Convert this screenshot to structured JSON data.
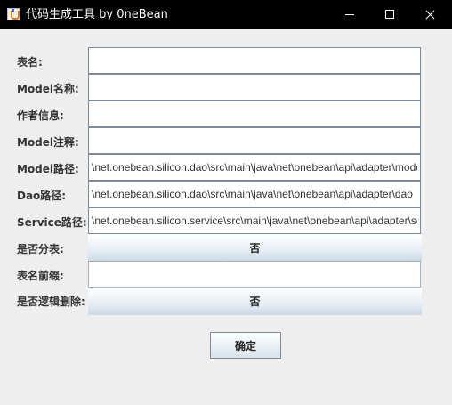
{
  "window": {
    "title": "代码生成工具 by 0neBean",
    "icon": "java-cup-icon",
    "controls": [
      "minimize-icon",
      "maximize-icon",
      "close-icon"
    ]
  },
  "form": {
    "table_name": {
      "label": "表名:",
      "value": ""
    },
    "model_name": {
      "label": "Model名称:",
      "value": ""
    },
    "author_info": {
      "label": "作者信息:",
      "value": ""
    },
    "model_comment": {
      "label": "Model注释:",
      "value": ""
    },
    "model_path": {
      "label": "Model路径:",
      "value": "\\net.onebean.silicon.dao\\src\\main\\java\\net\\onebean\\api\\adapter\\model"
    },
    "dao_path": {
      "label": "Dao路径:",
      "value": "\\net.onebean.silicon.dao\\src\\main\\java\\net\\onebean\\api\\adapter\\dao"
    },
    "service_path": {
      "label": "Service路径:",
      "value": "\\net.onebean.silicon.service\\src\\main\\java\\net\\onebean\\api\\adapter\\service"
    },
    "split_table": {
      "label": "是否分表:",
      "value": "否"
    },
    "table_prefix": {
      "label": "表名前缀:",
      "value": ""
    },
    "logic_delete": {
      "label": "是否逻辑删除:",
      "value": "否"
    }
  },
  "actions": {
    "confirm_label": "确定"
  }
}
